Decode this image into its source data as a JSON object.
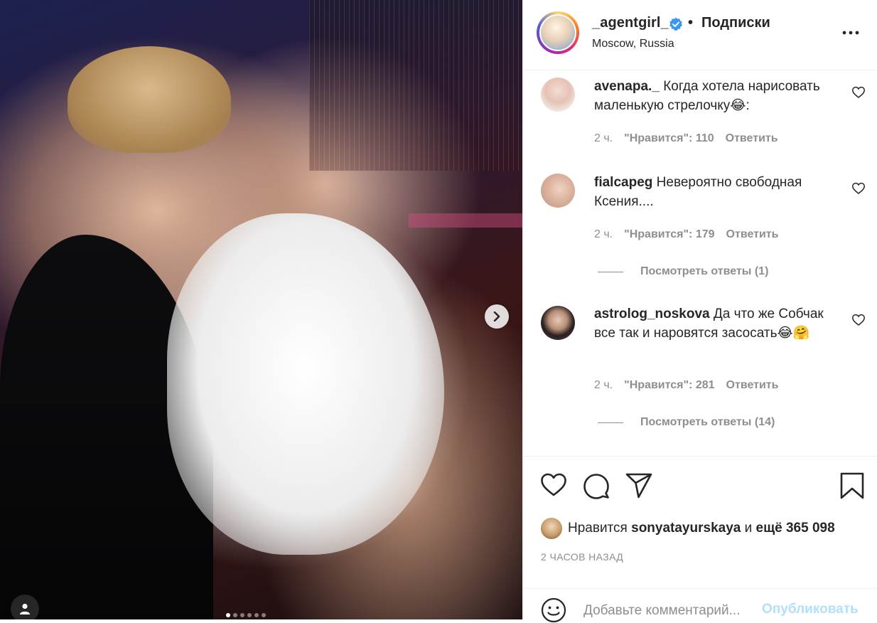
{
  "post": {
    "username": "_agentgirl_",
    "separator": "•",
    "follow_label": "Подписки",
    "location": "Moscow, Russia"
  },
  "comments": [
    {
      "username": "avenapa._",
      "text": "Когда хотела нарисовать маленькую стрелочку😂:",
      "time": "2 ч.",
      "likes": "\"Нравится\": 110",
      "reply": "Ответить"
    },
    {
      "username": "fialcapeg",
      "text": "Невероятно свободная Ксения....",
      "time": "2 ч.",
      "likes": "\"Нравится\": 179",
      "reply": "Ответить",
      "view_replies": "Посмотреть ответы (1)"
    },
    {
      "username": "astrolog_noskova",
      "text": "Да что же Собчак все так и наровятся засосать😂🤗",
      "time": "2 ч.",
      "likes": "\"Нравится\": 281",
      "reply": "Ответить",
      "view_replies": "Посмотреть ответы (14)"
    }
  ],
  "likes": {
    "prefix": "Нравится",
    "user": "sonyatayurskaya",
    "connector": "и",
    "rest": "ещё 365 098"
  },
  "timestamp": "2 ЧАСОВ НАЗАД",
  "add_comment": {
    "placeholder": "Добавьте комментарий...",
    "publish_label": "Опубликовать"
  },
  "carousel": {
    "total": 6,
    "active_index": 0
  },
  "colors": {
    "link_disabled": "#b2dffc",
    "verified": "#3897f0",
    "secondary_text": "#8e8e8e",
    "primary_text": "#262626"
  },
  "icons": [
    "verified-badge-icon",
    "more-options-icon",
    "heart-icon",
    "comment-icon",
    "share-icon",
    "bookmark-icon",
    "emoji-icon",
    "chevron-right-icon",
    "user-tag-icon"
  ]
}
